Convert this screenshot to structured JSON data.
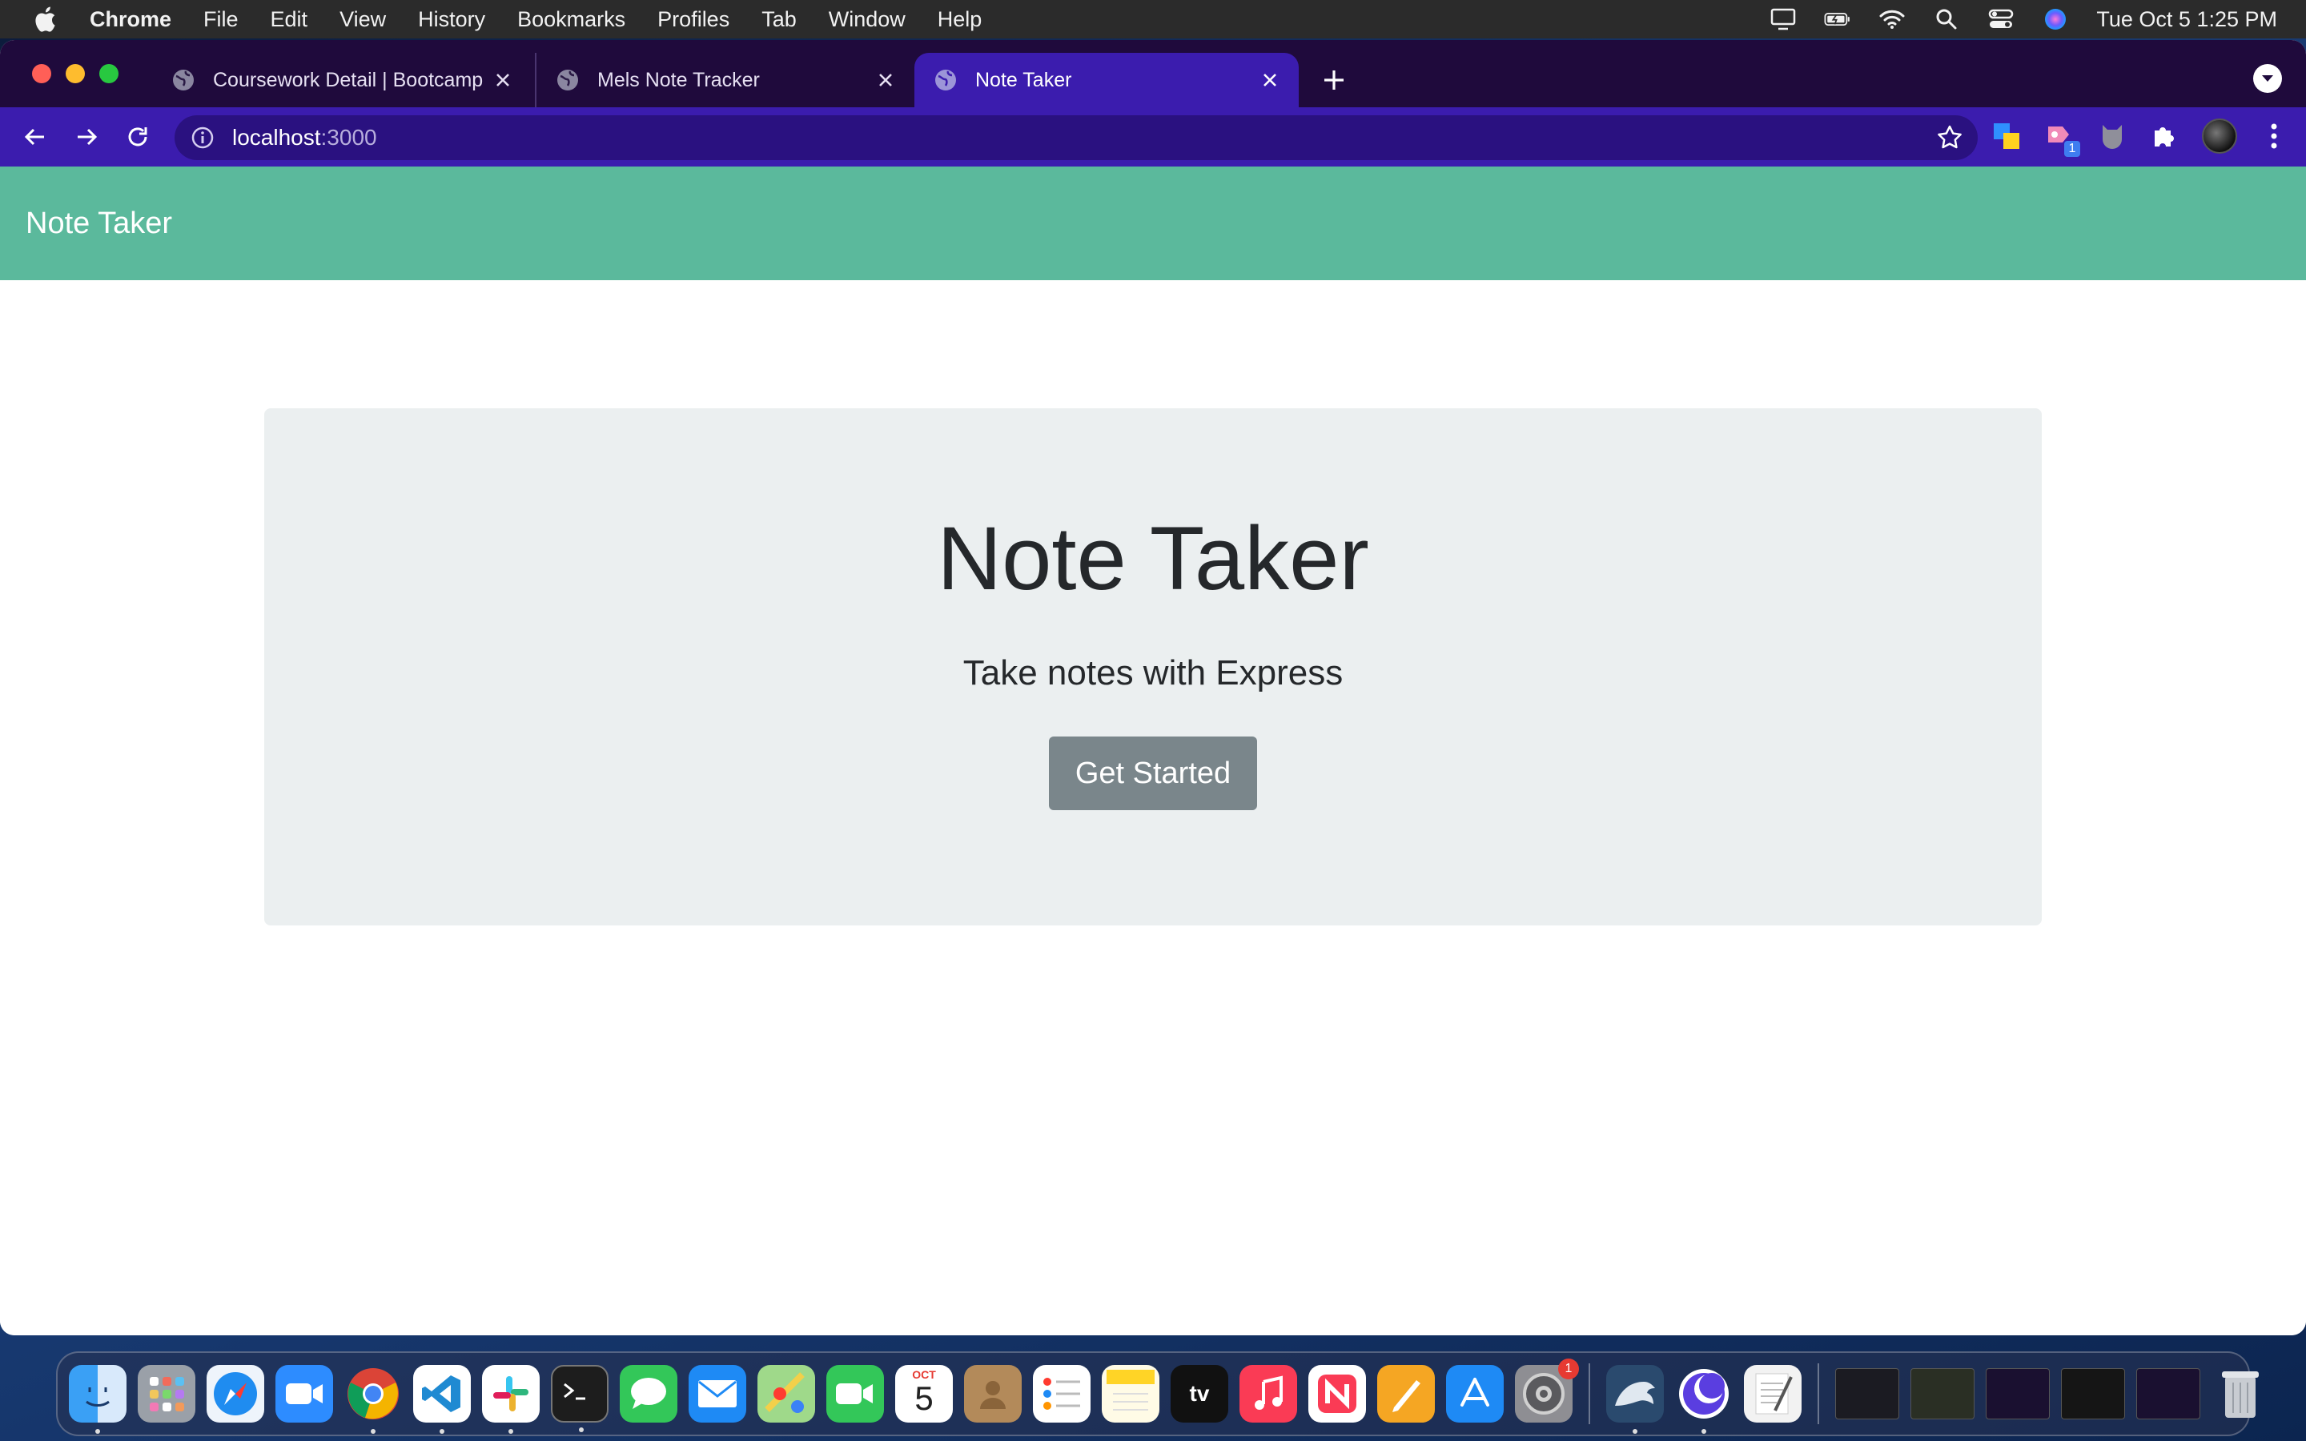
{
  "menubar": {
    "app_name": "Chrome",
    "items": [
      "File",
      "Edit",
      "View",
      "History",
      "Bookmarks",
      "Profiles",
      "Tab",
      "Window",
      "Help"
    ],
    "clock": "Tue Oct 5  1:25 PM"
  },
  "browser": {
    "tabs": [
      {
        "title": "Coursework Detail | Bootcamp"
      },
      {
        "title": "Mels Note Tracker"
      },
      {
        "title": "Note Taker"
      }
    ],
    "url_host": "localhost",
    "url_port": ":3000",
    "extension_badge": "1"
  },
  "app": {
    "brand": "Note Taker",
    "title": "Note Taker",
    "subtitle": "Take notes with Express",
    "cta_label": "Get Started"
  },
  "dock": {
    "calendar_month": "OCT",
    "calendar_day": "5",
    "settings_badge": "1",
    "tv_label": "tv"
  },
  "colors": {
    "navbar": "#5bb99c",
    "toolbar": "#3b1cae",
    "tabstrip": "#1f0a3c",
    "jumbotron": "#ebeff0",
    "button": "#7a868b"
  }
}
